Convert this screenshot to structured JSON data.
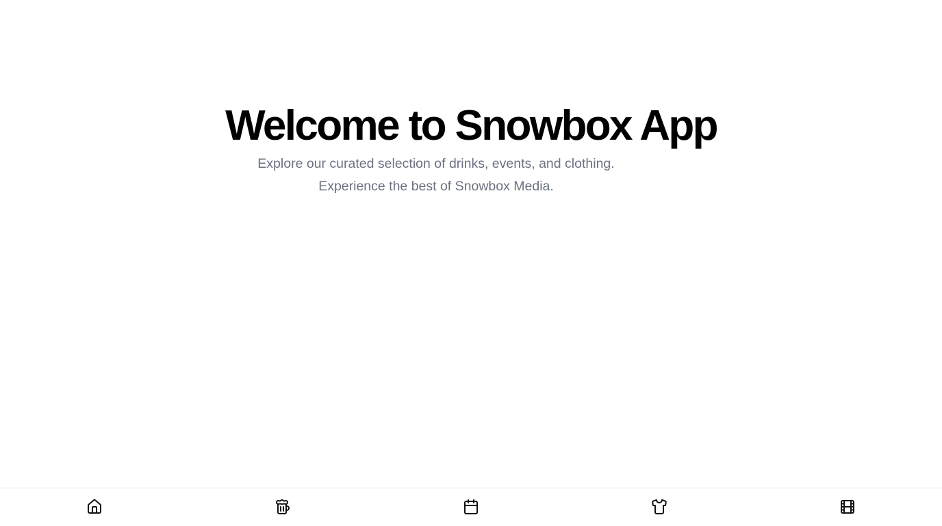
{
  "hero": {
    "title": "Welcome to Snowbox App",
    "subtitle": "Explore our curated selection of drinks, events, and clothing. Experience the best of Snowbox Media."
  },
  "colors": {
    "title": "#000000",
    "subtitle": "#6b7280",
    "nav_border": "#e5e7eb",
    "icon": "#111111"
  },
  "bottom_nav": {
    "items": [
      {
        "icon": "home-icon"
      },
      {
        "icon": "beer-mug-icon"
      },
      {
        "icon": "calendar-icon"
      },
      {
        "icon": "shirt-icon"
      },
      {
        "icon": "film-icon"
      }
    ]
  }
}
